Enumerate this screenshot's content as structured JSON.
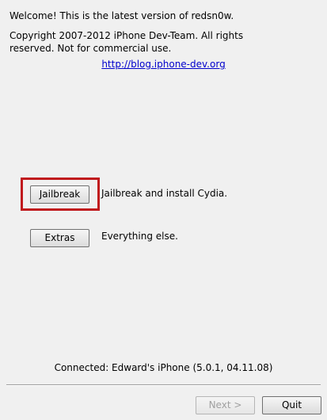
{
  "header": {
    "welcome": "Welcome!  This is the latest version of redsn0w.",
    "copyright": "Copyright 2007-2012 iPhone Dev-Team. All rights reserved. Not for commercial use.",
    "link": "http://blog.iphone-dev.org"
  },
  "actions": {
    "jailbreak_label": "Jailbreak",
    "jailbreak_desc": "Jailbreak and install Cydia.",
    "extras_label": "Extras",
    "extras_desc": "Everything else."
  },
  "status": {
    "connected": "Connected: Edward's iPhone (5.0.1, 04.11.08)"
  },
  "footer": {
    "next_label": "Next >",
    "quit_label": "Quit"
  },
  "colors": {
    "highlight": "#c0191d",
    "link": "#0000cc"
  }
}
